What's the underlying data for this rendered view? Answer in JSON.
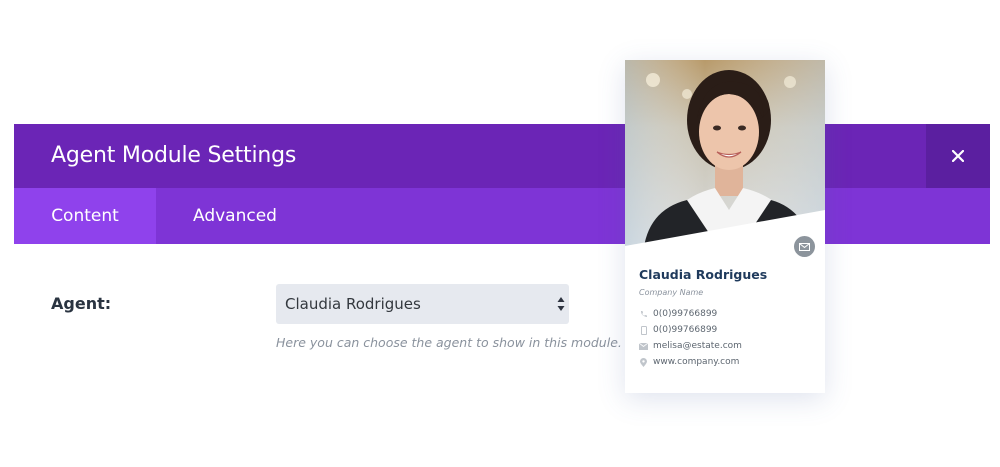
{
  "modal": {
    "title": "Agent Module Settings",
    "close_icon": "close-icon",
    "tabs": [
      {
        "label": "Content",
        "active": true
      },
      {
        "label": "Advanced",
        "active": false
      }
    ],
    "agent_field": {
      "label": "Agent:",
      "selected_value": "Claudia Rodrigues",
      "help_text": "Here you can choose the agent to show in this module."
    }
  },
  "agent_card": {
    "name": "Claudia Rodrigues",
    "company": "Company Name",
    "contacts": [
      {
        "icon": "phone-icon",
        "text": "0(0)99766899"
      },
      {
        "icon": "mobile-icon",
        "text": "0(0)99766899"
      },
      {
        "icon": "envelope-icon",
        "text": "melisa@estate.com"
      },
      {
        "icon": "location-pin-icon",
        "text": "www.company.com"
      }
    ]
  },
  "colors": {
    "header": "#6b25b6",
    "close_bg": "#5b1fa0",
    "tab_bar": "#7e34d6",
    "tab_active": "#8f42ec",
    "select_bg": "#e6e9ef",
    "agent_name": "#1f3a5c"
  }
}
